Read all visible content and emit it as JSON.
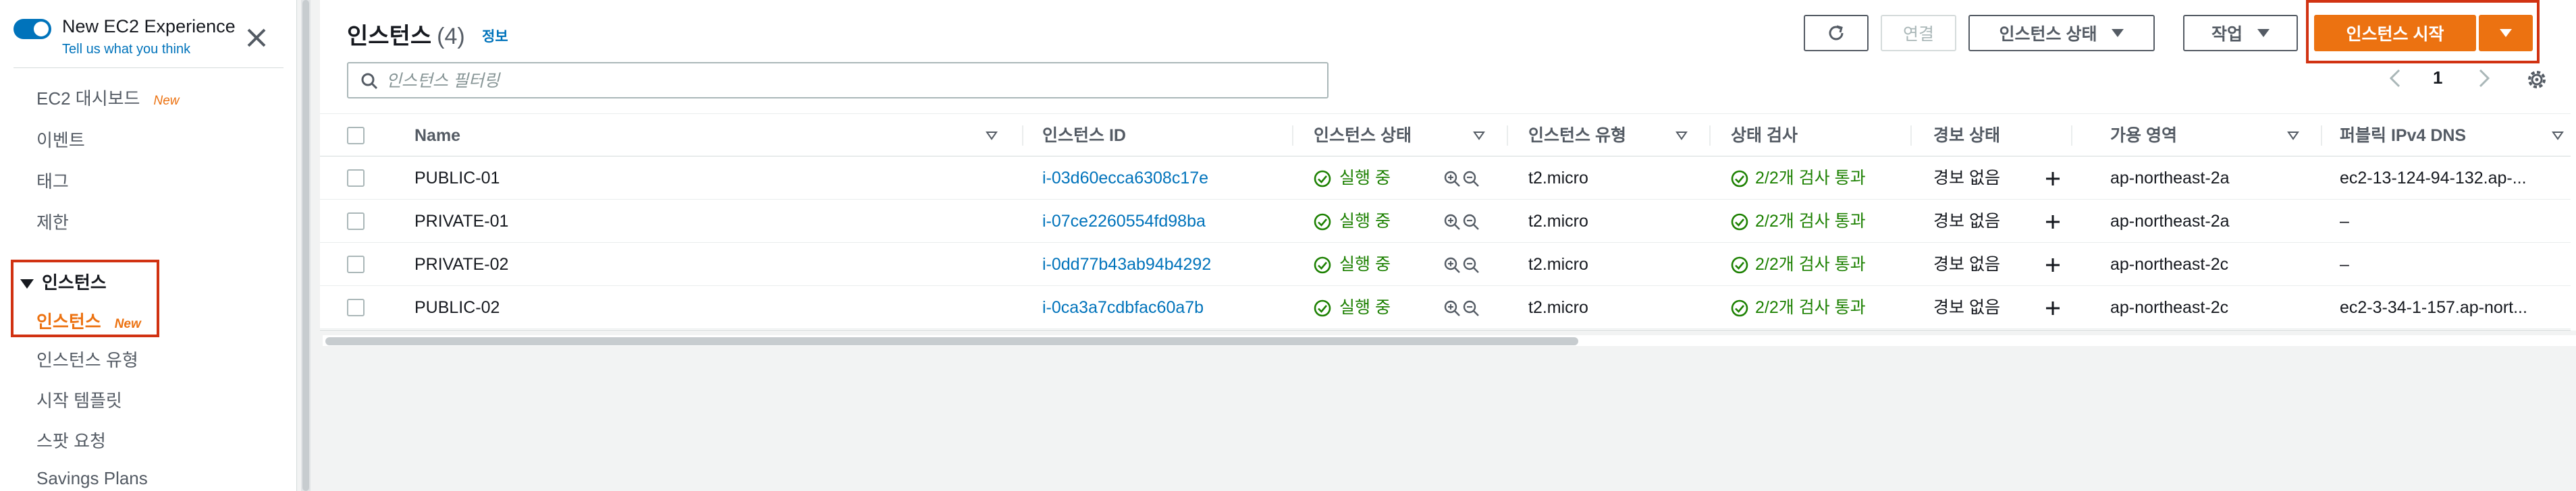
{
  "sidebar": {
    "toggle_title": "New EC2 Experience",
    "toggle_sub": "Tell us what you think",
    "items": [
      {
        "label": "EC2 대시보드",
        "badge": "New"
      },
      {
        "label": "이벤트"
      },
      {
        "label": "태그"
      },
      {
        "label": "제한"
      }
    ],
    "group_label": "인스턴스",
    "active_item": {
      "label": "인스턴스",
      "badge": "New"
    },
    "sub_items": [
      {
        "label": "인스턴스 유형"
      },
      {
        "label": "시작 템플릿"
      },
      {
        "label": "스팟 요청"
      },
      {
        "label": "Savings Plans"
      }
    ]
  },
  "header": {
    "title": "인스턴스",
    "count": "(4)",
    "info": "정보",
    "connect_label": "연결",
    "state_label": "인스턴스 상태",
    "actions_label": "작업",
    "launch_label": "인스턴스 시작"
  },
  "search": {
    "placeholder": "인스턴스 필터링"
  },
  "pager": {
    "page": "1"
  },
  "table": {
    "columns": [
      "Name",
      "인스턴스 ID",
      "인스턴스 상태",
      "인스턴스 유형",
      "상태 검사",
      "경보 상태",
      "가용 영역",
      "퍼블릭 IPv4 DNS"
    ],
    "rows": [
      {
        "name": "PUBLIC-01",
        "id": "i-03d60ecca6308c17e",
        "state": "실행 중",
        "type": "t2.micro",
        "check": "2/2개 검사 통과",
        "alarm": "경보 없음",
        "az": "ap-northeast-2a",
        "dns": "ec2-13-124-94-132.ap-..."
      },
      {
        "name": "PRIVATE-01",
        "id": "i-07ce2260554fd98ba",
        "state": "실행 중",
        "type": "t2.micro",
        "check": "2/2개 검사 통과",
        "alarm": "경보 없음",
        "az": "ap-northeast-2a",
        "dns": "–"
      },
      {
        "name": "PRIVATE-02",
        "id": "i-0dd77b43ab94b4292",
        "state": "실행 중",
        "type": "t2.micro",
        "check": "2/2개 검사 통과",
        "alarm": "경보 없음",
        "az": "ap-northeast-2c",
        "dns": "–"
      },
      {
        "name": "PUBLIC-02",
        "id": "i-0ca3a7cdbfac60a7b",
        "state": "실행 중",
        "type": "t2.micro",
        "check": "2/2개 검사 통과",
        "alarm": "경보 없음",
        "az": "ap-northeast-2c",
        "dns": "ec2-3-34-1-157.ap-nort..."
      }
    ]
  },
  "icons": {
    "refresh": "refresh-icon",
    "search": "search-icon",
    "settings": "gear-icon",
    "status_ok": "check-circle-icon",
    "zoom": "zoom-in-out-icon",
    "alarm_add": "plus-icon"
  },
  "colors": {
    "accent": "#ec7211",
    "link": "#0073bb",
    "success": "#1d8102",
    "highlight": "#d13212"
  }
}
